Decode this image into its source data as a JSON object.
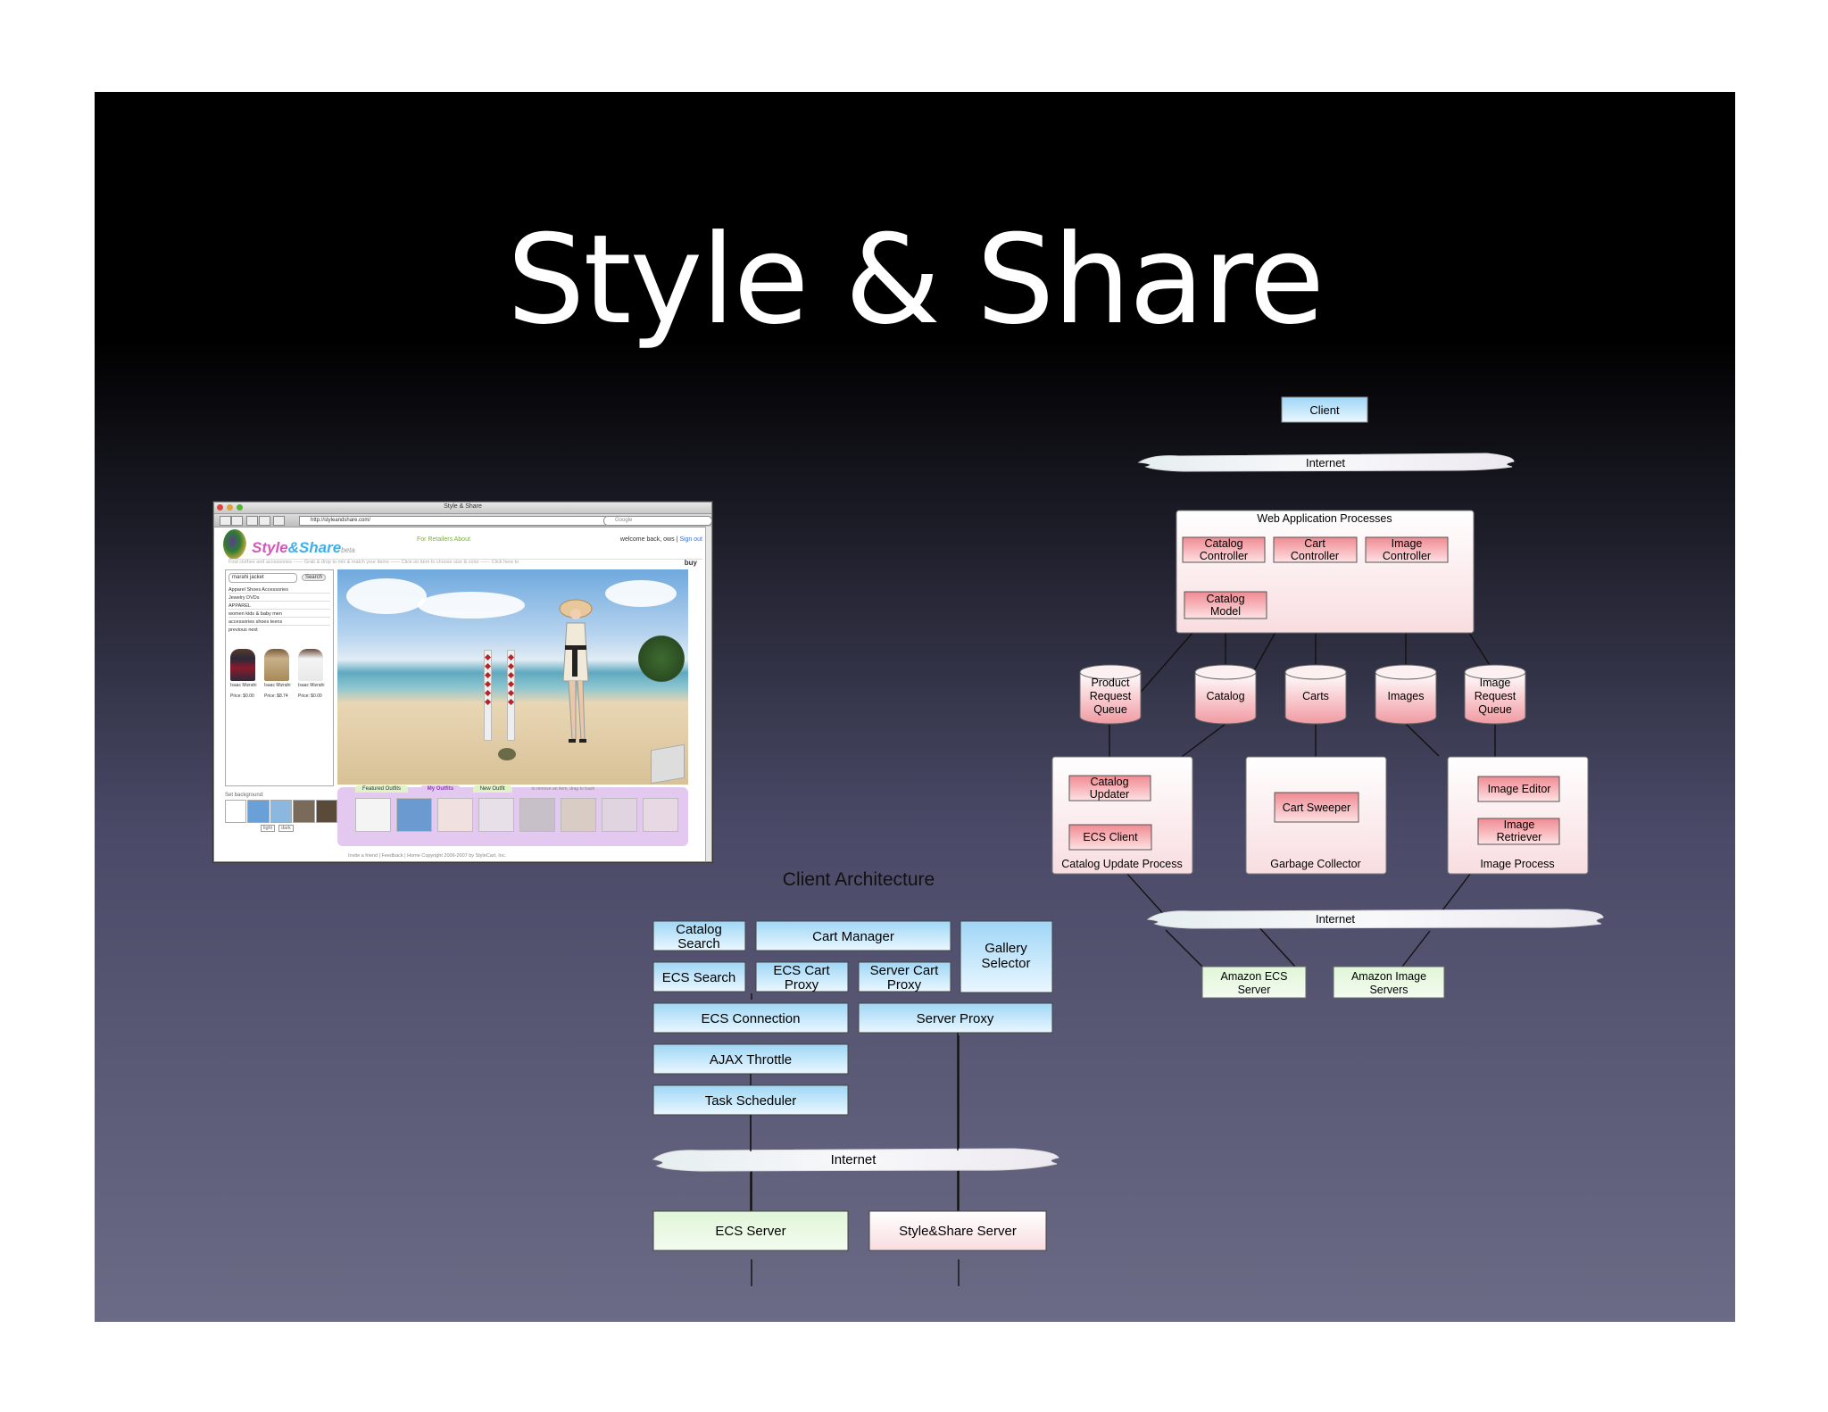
{
  "slide": {
    "title": "Style & Share",
    "background_top": "#000000",
    "background_bottom": "#6b6b86"
  },
  "colors": {
    "client_blue": "#c8e6fb",
    "controller_red": "#f6b3b8",
    "process_pink": "#fbeaec",
    "server_green": "#e8f8e0",
    "internet_cloud": "#f2f2f7",
    "line": "#111111"
  },
  "server_architecture": {
    "client": "Client",
    "internet_top": "Internet",
    "web_app": {
      "title": "Web Application Processes",
      "catalog_controller": [
        "Catalog",
        "Controller"
      ],
      "cart_controller": [
        "Cart",
        "Controller"
      ],
      "image_controller": [
        "Image",
        "Controller"
      ],
      "catalog_model": [
        "Catalog",
        "Model"
      ]
    },
    "stores": {
      "product_request_queue": [
        "Product",
        "Request",
        "Queue"
      ],
      "catalog": "Catalog",
      "carts": "Carts",
      "images": "Images",
      "image_request_queue": [
        "Image",
        "Request",
        "Queue"
      ]
    },
    "catalog_update_process": {
      "title": "Catalog Update Process",
      "catalog_updater": [
        "Catalog",
        "Updater"
      ],
      "ecs_client": "ECS Client"
    },
    "garbage_collector": {
      "title": "Garbage Collector",
      "cart_sweeper": "Cart Sweeper"
    },
    "image_process": {
      "title": "Image Process",
      "image_editor": "Image Editor",
      "image_retriever": [
        "Image",
        "Retriever"
      ]
    },
    "internet_bottom": "Internet",
    "amazon_ecs_server": [
      "Amazon ECS",
      "Server"
    ],
    "amazon_image_servers": [
      "Amazon Image",
      "Servers"
    ]
  },
  "client_architecture": {
    "title": "Client Architecture",
    "catalog_search": [
      "Catalog",
      "Search"
    ],
    "cart_manager": "Cart Manager",
    "gallery_selector": [
      "Gallery",
      "Selector"
    ],
    "ecs_search": "ECS Search",
    "ecs_cart_proxy": [
      "ECS Cart",
      "Proxy"
    ],
    "server_cart_proxy": [
      "Server Cart",
      "Proxy"
    ],
    "ecs_connection": "ECS Connection",
    "server_proxy": "Server Proxy",
    "ajax_throttle": "AJAX Throttle",
    "task_scheduler": "Task Scheduler",
    "internet": "Internet",
    "ecs_server": "ECS Server",
    "styleshare_server": "Style&Share Server"
  },
  "screenshot": {
    "window_title": "Style & Share",
    "url": "http://styleandshare.com/",
    "search_placeholder": "Google",
    "logo_style": "Style",
    "logo_amp": "&",
    "logo_share": "Share",
    "logo_beta": "beta",
    "top_links": "For Retailers   About",
    "welcome": "welcome back, ows |",
    "sign_out": "Sign out",
    "steps": "Find clothes and accessories ——  Grab & drop to mix & match your items ——  Click on item to choose size & color ——  Click here to",
    "buy": "buy",
    "search_value": "marahi jacket",
    "search_button": "Search",
    "categories": [
      "Apparel   Shoes   Accessories",
      "Jewelry   DVDs",
      "APPAREL",
      "women   kids & baby   men",
      "accessories   shoes   teens"
    ],
    "pager": "previous                                next",
    "products": [
      {
        "name": "Isaac Mizrahi",
        "price": "Price: $0.00"
      },
      {
        "name": "Isaac Mizrahi",
        "price": "Price: $8.74"
      },
      {
        "name": "Isaac Mizrahi",
        "price": "Price: $0.00"
      }
    ],
    "set_background": "Set background:",
    "bg_buttons": [
      "light",
      "dark"
    ],
    "tabs": [
      "Featured Outfits",
      "My Outfits",
      "New Outfit"
    ],
    "remove_hint": "to remove an item, drag to trash",
    "footer": "Invite a friend | Feedback | Home        Copyright 2006-2007 by StyleCart, Inc."
  }
}
